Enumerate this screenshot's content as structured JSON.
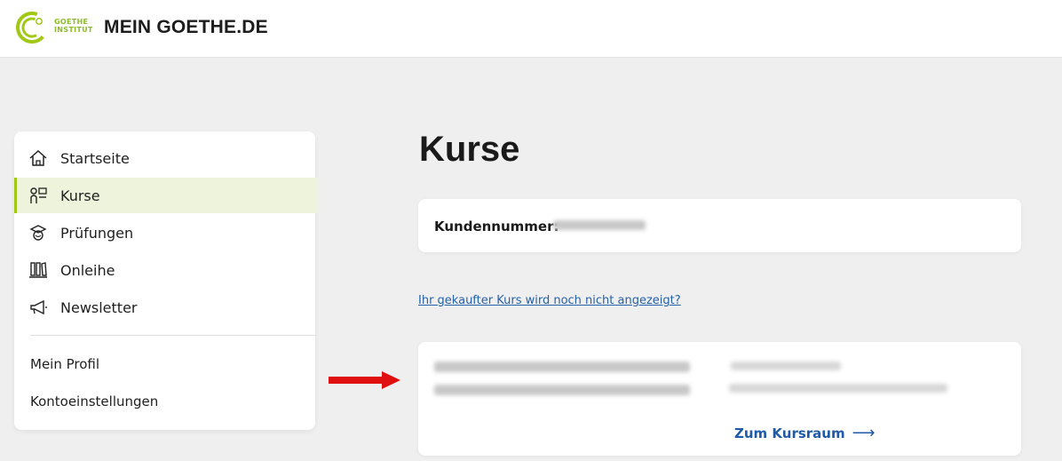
{
  "header": {
    "logo_line1": "GOETHE",
    "logo_line2": "INSTITUT",
    "brand": "MEIN GOETHE.DE"
  },
  "sidebar": {
    "items": [
      {
        "label": "Startseite",
        "icon": "home-icon",
        "active": false
      },
      {
        "label": "Kurse",
        "icon": "kurse-icon",
        "active": true
      },
      {
        "label": "Prüfungen",
        "icon": "exam-icon",
        "active": false
      },
      {
        "label": "Onleihe",
        "icon": "library-icon",
        "active": false
      },
      {
        "label": "Newsletter",
        "icon": "megaphone-icon",
        "active": false
      }
    ],
    "profile_label": "Mein Profil",
    "settings_label": "Kontoeinstellungen"
  },
  "main": {
    "title": "Kurse",
    "customer_label": "Kundennummer:",
    "help_link": "Ihr gekaufter Kurs wird noch nicht angezeigt?",
    "course_link": "Zum Kursraum",
    "course_link_arrow": "⟶"
  },
  "colors": {
    "accent_green": "#a0c814",
    "active_bg": "#eef3dc",
    "link_blue": "#1e5aa8",
    "annotation_red": "#e01010"
  }
}
